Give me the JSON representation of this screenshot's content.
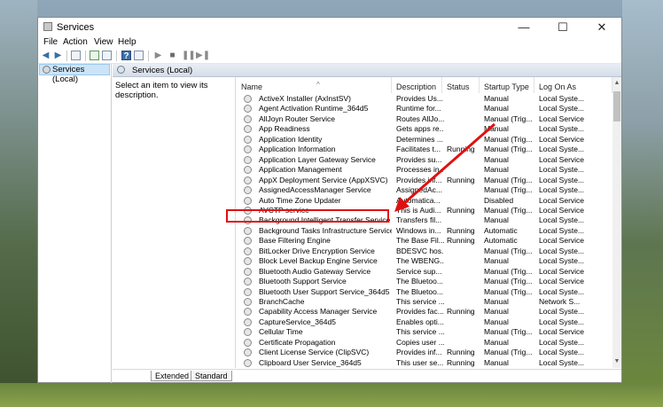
{
  "window": {
    "title": "Services",
    "minimize": "—",
    "maximize": "☐",
    "close": "✕"
  },
  "menu": [
    "File",
    "Action",
    "View",
    "Help"
  ],
  "tree": {
    "label": "Services (Local)"
  },
  "content": {
    "header": "Services (Local)",
    "description": "Select an item to view its description."
  },
  "columns": [
    "Name",
    "Description",
    "Status",
    "Startup Type",
    "Log On As"
  ],
  "rows": [
    [
      "ActiveX Installer (AxInstSV)",
      "Provides Us...",
      "",
      "Manual",
      "Local Syste..."
    ],
    [
      "Agent Activation Runtime_364d5",
      "Runtime for...",
      "",
      "Manual",
      "Local Syste..."
    ],
    [
      "AllJoyn Router Service",
      "Routes AllJo...",
      "",
      "Manual (Trig...",
      "Local Service"
    ],
    [
      "App Readiness",
      "Gets apps re...",
      "",
      "Manual",
      "Local Syste..."
    ],
    [
      "Application Identity",
      "Determines ...",
      "",
      "Manual (Trig...",
      "Local Service"
    ],
    [
      "Application Information",
      "Facilitates t...",
      "Running",
      "Manual (Trig...",
      "Local Syste..."
    ],
    [
      "Application Layer Gateway Service",
      "Provides su...",
      "",
      "Manual",
      "Local Service"
    ],
    [
      "Application Management",
      "Processes in...",
      "",
      "Manual",
      "Local Syste..."
    ],
    [
      "AppX Deployment Service (AppXSVC)",
      "Provides inf...",
      "Running",
      "Manual (Trig...",
      "Local Syste..."
    ],
    [
      "AssignedAccessManager Service",
      "AssignedAc...",
      "",
      "Manual (Trig...",
      "Local Syste..."
    ],
    [
      "Auto Time Zone Updater",
      "Automatica...",
      "",
      "Disabled",
      "Local Service"
    ],
    [
      "AVCTP service",
      "This is Audi...",
      "Running",
      "Manual (Trig...",
      "Local Service"
    ],
    [
      "Background Intelligent Transfer Service",
      "Transfers fil...",
      "",
      "Manual",
      "Local Syste..."
    ],
    [
      "Background Tasks Infrastructure Service",
      "Windows in...",
      "Running",
      "Automatic",
      "Local Syste..."
    ],
    [
      "Base Filtering Engine",
      "The Base Fil...",
      "Running",
      "Automatic",
      "Local Service"
    ],
    [
      "BitLocker Drive Encryption Service",
      "BDESVC hos...",
      "",
      "Manual (Trig...",
      "Local Syste..."
    ],
    [
      "Block Level Backup Engine Service",
      "The WBENG...",
      "",
      "Manual",
      "Local Syste..."
    ],
    [
      "Bluetooth Audio Gateway Service",
      "Service sup...",
      "",
      "Manual (Trig...",
      "Local Service"
    ],
    [
      "Bluetooth Support Service",
      "The Bluetoo...",
      "",
      "Manual (Trig...",
      "Local Service"
    ],
    [
      "Bluetooth User Support Service_364d5",
      "The Bluetoo...",
      "",
      "Manual (Trig...",
      "Local Syste..."
    ],
    [
      "BranchCache",
      "This service ...",
      "",
      "Manual",
      "Network S..."
    ],
    [
      "Capability Access Manager Service",
      "Provides fac...",
      "Running",
      "Manual",
      "Local Syste..."
    ],
    [
      "CaptureService_364d5",
      "Enables opti...",
      "",
      "Manual",
      "Local Syste..."
    ],
    [
      "Cellular Time",
      "This service ...",
      "",
      "Manual (Trig...",
      "Local Service"
    ],
    [
      "Certificate Propagation",
      "Copies user ...",
      "",
      "Manual",
      "Local Syste..."
    ],
    [
      "Client License Service (ClipSVC)",
      "Provides inf...",
      "Running",
      "Manual (Trig...",
      "Local Syste..."
    ],
    [
      "Clipboard User Service_364d5",
      "This user se...",
      "Running",
      "Manual",
      "Local Syste..."
    ]
  ],
  "tabs": [
    "Extended",
    "Standard"
  ],
  "highlight": {
    "row": "Background Intelligent Transfer Service",
    "color": "#e01010"
  }
}
